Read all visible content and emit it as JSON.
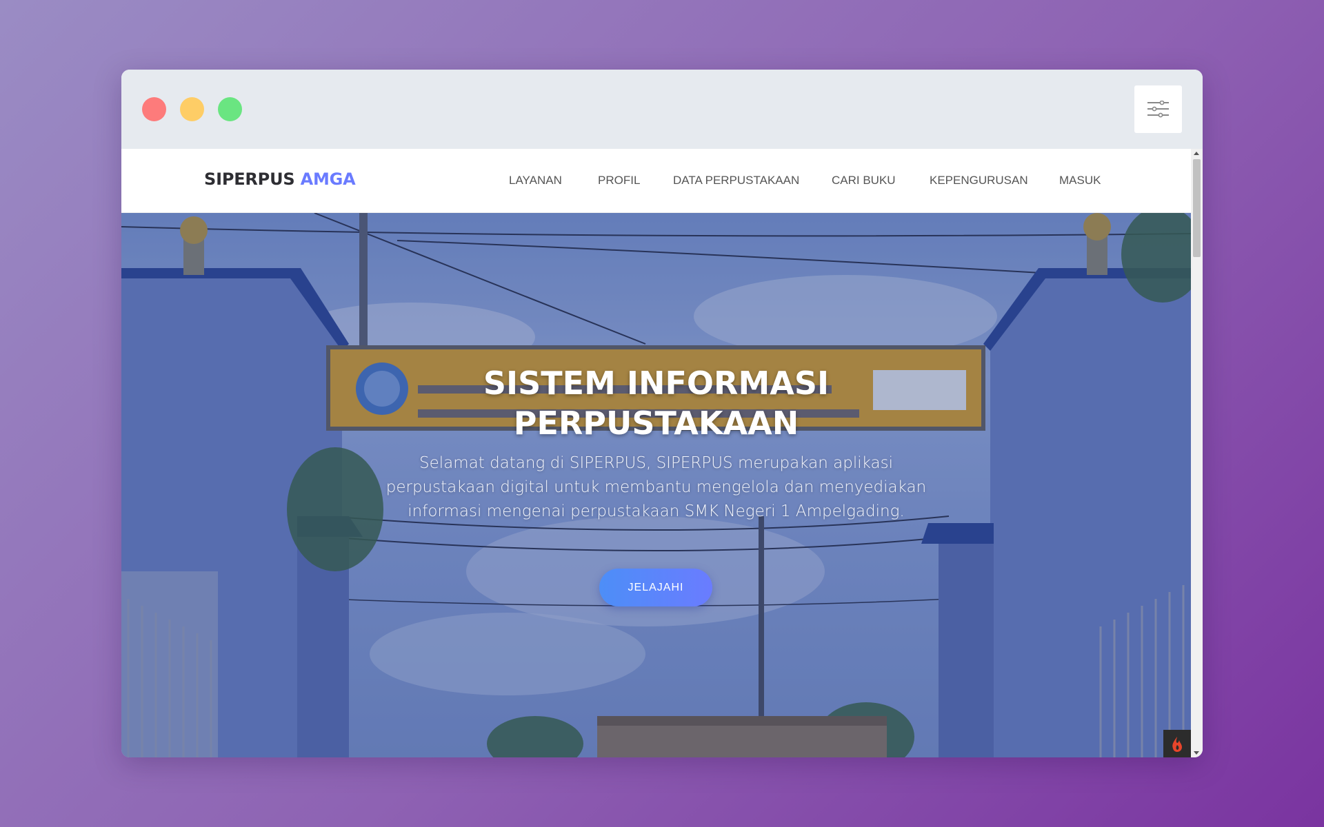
{
  "window": {
    "controls": [
      "close-dot",
      "minimize-dot",
      "maximize-dot"
    ],
    "settings_icon": "sliders-icon"
  },
  "navbar": {
    "brand_main": "SIPERPUS",
    "brand_accent": "AMGA",
    "brand_accent_color": "#6a7bff",
    "links": [
      "LAYANAN",
      "PROFIL",
      "DATA PERPUSTAKAAN",
      "CARI BUKU",
      "KEPENGURUSAN",
      "MASUK"
    ]
  },
  "hero": {
    "title_line1": "SISTEM INFORMASI",
    "title_line2": "PERPUSTAKAAN",
    "description": "Selamat datang di SIPERPUS, SIPERPUS merupakan aplikasi perpustakaan digital untuk membantu mengelola dan menyediakan informasi mengenai perpustakaan SMK Negeri 1 Ampelgading.",
    "button_label": "JELAJAHI",
    "button_gradient": [
      "#4d8ef7",
      "#6a7cff"
    ]
  },
  "badge": {
    "icon": "fire-icon"
  }
}
